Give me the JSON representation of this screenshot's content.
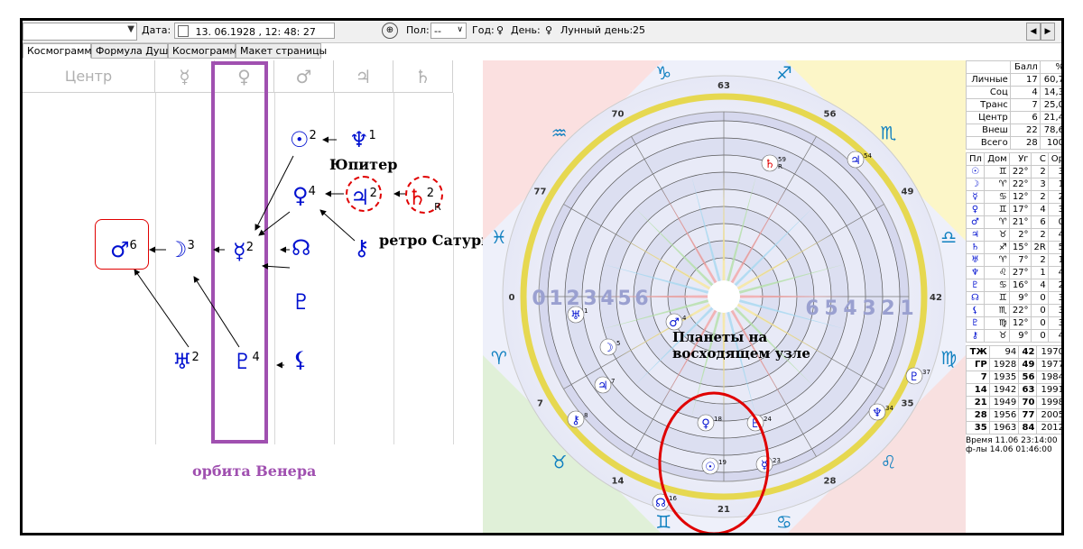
{
  "toolbar": {
    "date_label": "Дата:",
    "date_value": "13. 06.1928 , 12: 48: 27",
    "pol_label": "Пол:",
    "pol_value": "--",
    "year_label": "Год:",
    "year_symbol": "♀",
    "day_label": "День:",
    "day_symbol": "♀",
    "lunar_day_label": "Лунный день:",
    "lunar_day_value": "25"
  },
  "tabs": [
    "Космограмма",
    "Формула Души",
    "Космограмма",
    "Макет страницы"
  ],
  "columns": [
    "Центр",
    "☿",
    "♀",
    "♂",
    "♃",
    "♄"
  ],
  "formula": {
    "sun": {
      "symbol": "☉",
      "num": "2"
    },
    "neptune": {
      "symbol": "♆",
      "num": "1"
    },
    "venus": {
      "symbol": "♀",
      "num": "4"
    },
    "jupiter": {
      "symbol": "♃",
      "num": "2"
    },
    "saturn": {
      "symbol": "♄",
      "num": "2",
      "retro": "R"
    },
    "mars": {
      "symbol": "♂",
      "num": "6"
    },
    "moon": {
      "symbol": "☽",
      "num": "3"
    },
    "mercury": {
      "symbol": "☿",
      "num": "2"
    },
    "node": {
      "symbol": "☊"
    },
    "chiron": {
      "symbol": "⚷"
    },
    "proserpina": {
      "symbol": "♇"
    },
    "uranus": {
      "symbol": "♅",
      "num": "2"
    },
    "pluto": {
      "symbol": "♇",
      "num": "4"
    },
    "lilith": {
      "symbol": "⚸"
    }
  },
  "annotations": {
    "jupiter": "Юпитер",
    "retro_saturn": "ретро Сатурн",
    "venus_orbit": "орбита Венера",
    "ascending_node": "Планеты на восходящем узле"
  },
  "wheel": {
    "degree_labels": [
      "63",
      "56",
      "49",
      "42",
      "35",
      "28",
      "21",
      "14",
      "7",
      "0",
      "77",
      "70"
    ],
    "houses_left": [
      "0",
      "1",
      "2",
      "3",
      "4",
      "5",
      "6"
    ],
    "houses_right": [
      "6",
      "5",
      "4",
      "3",
      "2",
      "1"
    ],
    "planets": [
      {
        "symbol": "♄",
        "deg": "59",
        "retro": "R"
      },
      {
        "symbol": "♃",
        "deg": "54"
      },
      {
        "symbol": "♅",
        "deg": "1"
      },
      {
        "symbol": "♂",
        "deg": "4"
      },
      {
        "symbol": "☽",
        "deg": "5"
      },
      {
        "symbol": "♃",
        "deg": "7"
      },
      {
        "symbol": "⚷",
        "deg": "8"
      },
      {
        "symbol": "♀",
        "deg": "18"
      },
      {
        "symbol": "☉",
        "deg": "19"
      },
      {
        "symbol": "♇",
        "deg": "24"
      },
      {
        "symbol": "☿",
        "deg": "23"
      },
      {
        "symbol": "☊",
        "deg": "16"
      },
      {
        "symbol": "♆",
        "deg": "34"
      },
      {
        "symbol": "♇",
        "deg": "37"
      }
    ],
    "signs": [
      "♑",
      "♐",
      "♏",
      "♎",
      "♍",
      "♌",
      "♋",
      "♊",
      "♉",
      "♈",
      "♓",
      "♒"
    ]
  },
  "score_table": {
    "headers": [
      "",
      "Балл",
      "%"
    ],
    "rows": [
      [
        "Личные",
        "17",
        "60,7"
      ],
      [
        "Соц",
        "4",
        "14,3"
      ],
      [
        "Транс",
        "7",
        "25,0"
      ],
      [
        "Центр",
        "6",
        "21,4"
      ],
      [
        "Внеш",
        "22",
        "78,6"
      ],
      [
        "Всего",
        "28",
        "100"
      ]
    ]
  },
  "planet_table": {
    "headers": [
      "Пл",
      "Дом",
      "Уг",
      "С",
      "Ор"
    ],
    "rows": [
      [
        "☉",
        "♊",
        "22°",
        "2",
        "3"
      ],
      [
        "☽",
        "♈",
        "22°",
        "3",
        "1"
      ],
      [
        "☿",
        "♋",
        "12°",
        "2",
        "2"
      ],
      [
        "♀",
        "♊",
        "17°",
        "4",
        "3"
      ],
      [
        "♂",
        "♈",
        "21°",
        "6",
        "0"
      ],
      [
        "♃",
        "♉",
        "2°",
        "2",
        "4"
      ],
      [
        "♄",
        "♐",
        "15°",
        "2R",
        "5"
      ],
      [
        "♅",
        "♈",
        "7°",
        "2",
        "1"
      ],
      [
        "♆",
        "♌",
        "27°",
        "1",
        "4"
      ],
      [
        "♇",
        "♋",
        "16°",
        "4",
        "2"
      ],
      [
        "☊",
        "♊",
        "9°",
        "0",
        "3"
      ],
      [
        "⚸",
        "♏",
        "22°",
        "0",
        "3"
      ],
      [
        "♇",
        "♍",
        "12°",
        "0",
        "3"
      ],
      [
        "⚷",
        "♉",
        "9°",
        "0",
        "4"
      ]
    ]
  },
  "years_table": {
    "header": [
      "ТЖ",
      "94",
      "42",
      "1970"
    ],
    "rows": [
      [
        "ГР",
        "1928",
        "49",
        "1977"
      ],
      [
        "7",
        "1935",
        "56",
        "1984"
      ],
      [
        "14",
        "1942",
        "63",
        "1991"
      ],
      [
        "21",
        "1949",
        "70",
        "1998"
      ],
      [
        "28",
        "1956",
        "77",
        "2005"
      ],
      [
        "35",
        "1963",
        "84",
        "2012"
      ]
    ]
  },
  "footer": {
    "time_label": "Время",
    "time_value": "11.06 23:14:00",
    "formula_label": "ф-лы",
    "formula_value": "14.06 01:46:00"
  },
  "colors": {
    "accent": "#a050b0",
    "planet_blue": "#0010d0",
    "saturn_red": "#e00000"
  }
}
